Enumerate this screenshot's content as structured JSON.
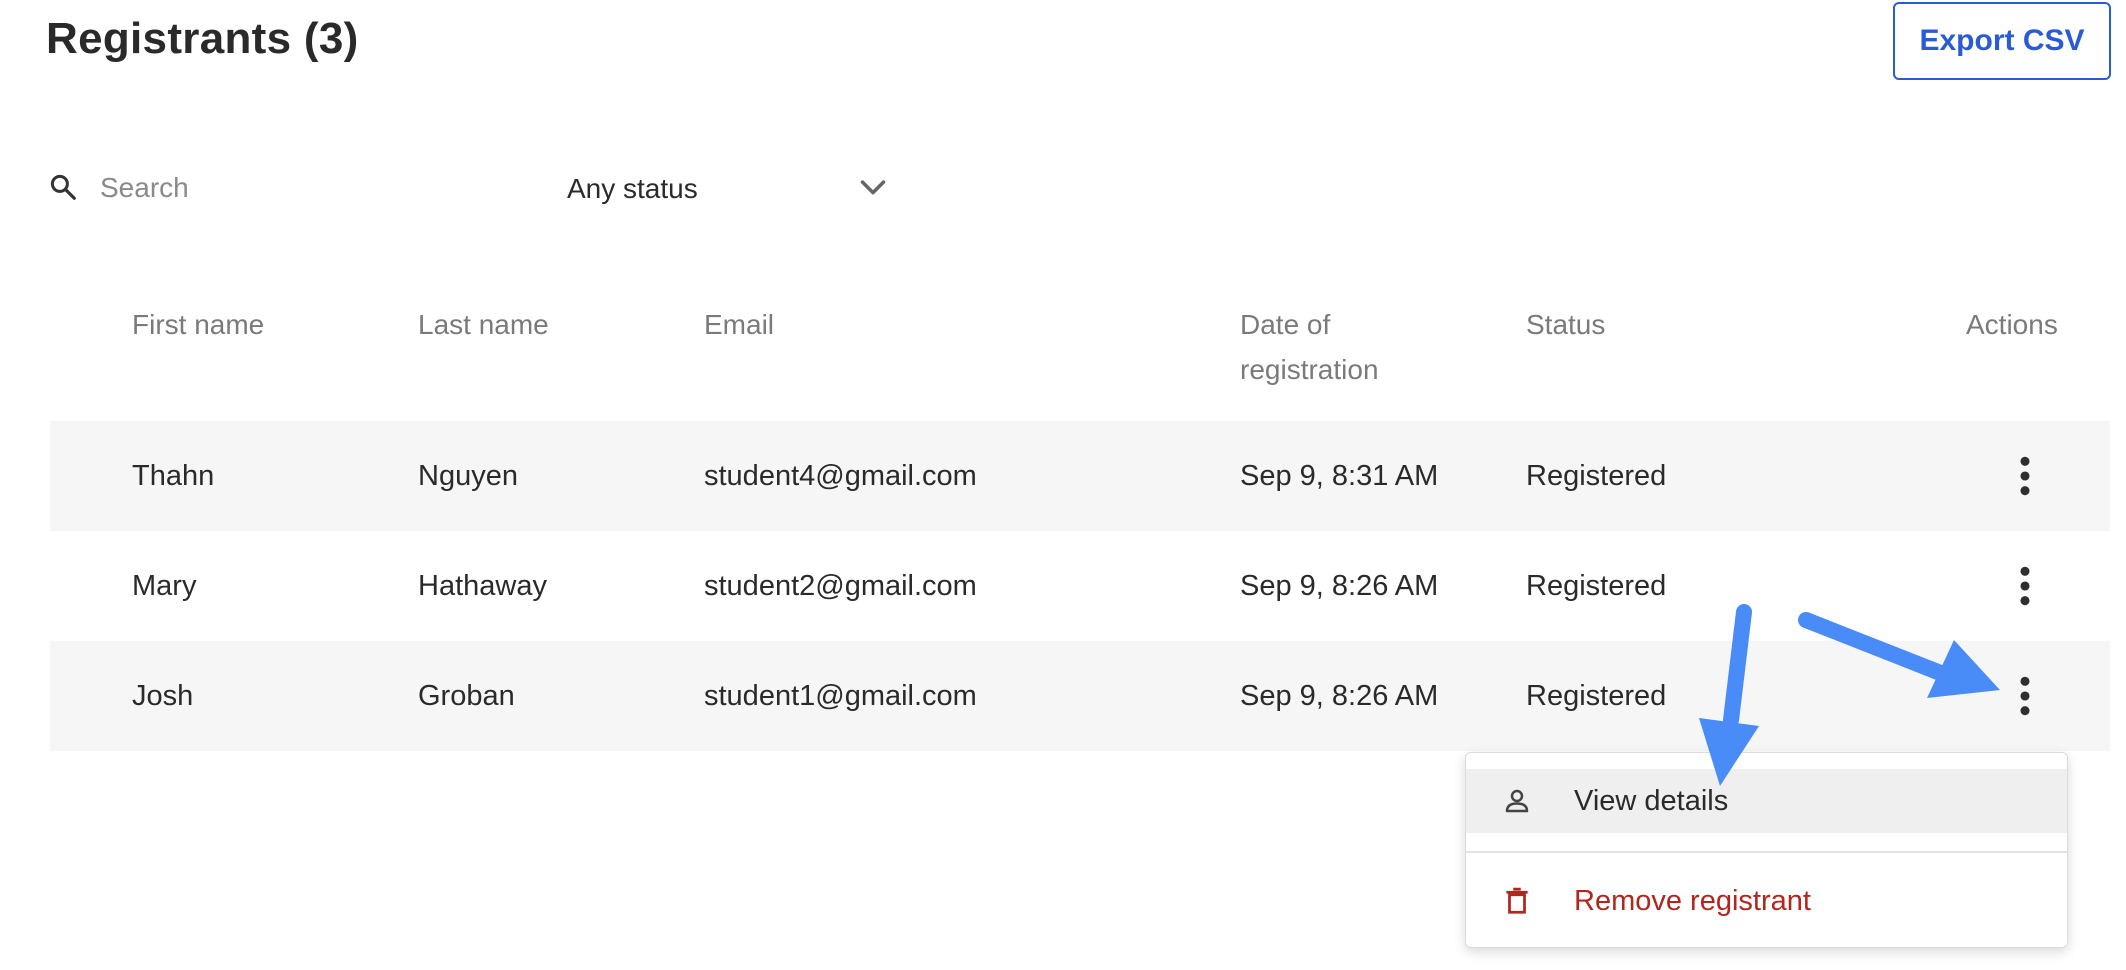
{
  "header": {
    "title": "Registrants (3)",
    "export_label": "Export CSV"
  },
  "filters": {
    "search_placeholder": "Search",
    "search_value": "",
    "status_value": "Any status"
  },
  "table": {
    "columns": [
      "First name",
      "Last name",
      "Email",
      "Date of registration",
      "Status",
      "Actions"
    ],
    "date_col_line1": "Date of",
    "date_col_line2": "registration",
    "rows": [
      {
        "first": "Thahn",
        "last": "Nguyen",
        "email": "student4@gmail.com",
        "date": "Sep 9, 8:31 AM",
        "status": "Registered"
      },
      {
        "first": "Mary",
        "last": "Hathaway",
        "email": "student2@gmail.com",
        "date": "Sep 9, 8:26 AM",
        "status": "Registered"
      },
      {
        "first": "Josh",
        "last": "Groban",
        "email": "student1@gmail.com",
        "date": "Sep 9, 8:26 AM",
        "status": "Registered"
      }
    ]
  },
  "actions_menu": {
    "items": [
      {
        "label": "View details",
        "icon": "person-icon"
      },
      {
        "label": "Remove registrant",
        "icon": "trash-icon",
        "color": "#b3261e"
      }
    ]
  },
  "colors": {
    "accent": "#2a5bd7",
    "danger": "#b3261e",
    "annotation_arrow": "#4a8cf7",
    "row_shade": "#f6f6f7"
  }
}
